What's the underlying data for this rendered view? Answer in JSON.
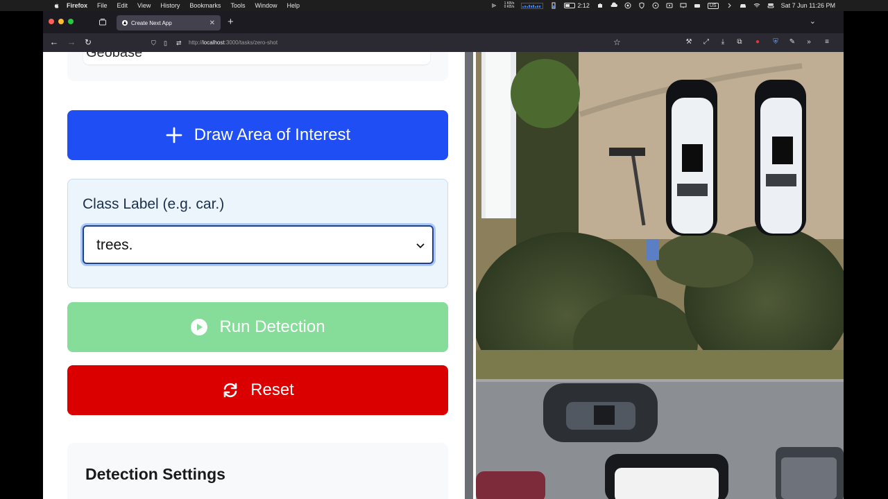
{
  "menubar": {
    "app_name": "Firefox",
    "items": [
      "File",
      "Edit",
      "View",
      "History",
      "Bookmarks",
      "Tools",
      "Window",
      "Help"
    ],
    "net_up": "1 KB/s",
    "net_down": "0 KB/s",
    "battery_time": "2:12",
    "battery_level": 0.45,
    "input_source": "US",
    "datetime": "Sat 7 Jun  11:26 PM"
  },
  "browser": {
    "tab_title": "Create Next App",
    "new_tab": "+",
    "url_scheme": "http://",
    "url_host": "localhost",
    "url_path": ":3000/tasks/zero-shot"
  },
  "panel": {
    "geobase_value": "Geobase",
    "draw_button_label": "Draw Area of Interest",
    "class_label_title": "Class Label (e.g. car.)",
    "class_label_value": "trees.",
    "run_button_label": "Run Detection",
    "reset_button_label": "Reset",
    "settings_title": "Detection Settings"
  },
  "colors": {
    "draw_button": "#1f4ef5",
    "run_button": "#86dd99",
    "reset_button": "#da0000",
    "class_card_bg": "#ecf4fc"
  },
  "icons": {
    "draw": "plus-icon",
    "run": "play-circle-icon",
    "reset": "refresh-icon"
  }
}
